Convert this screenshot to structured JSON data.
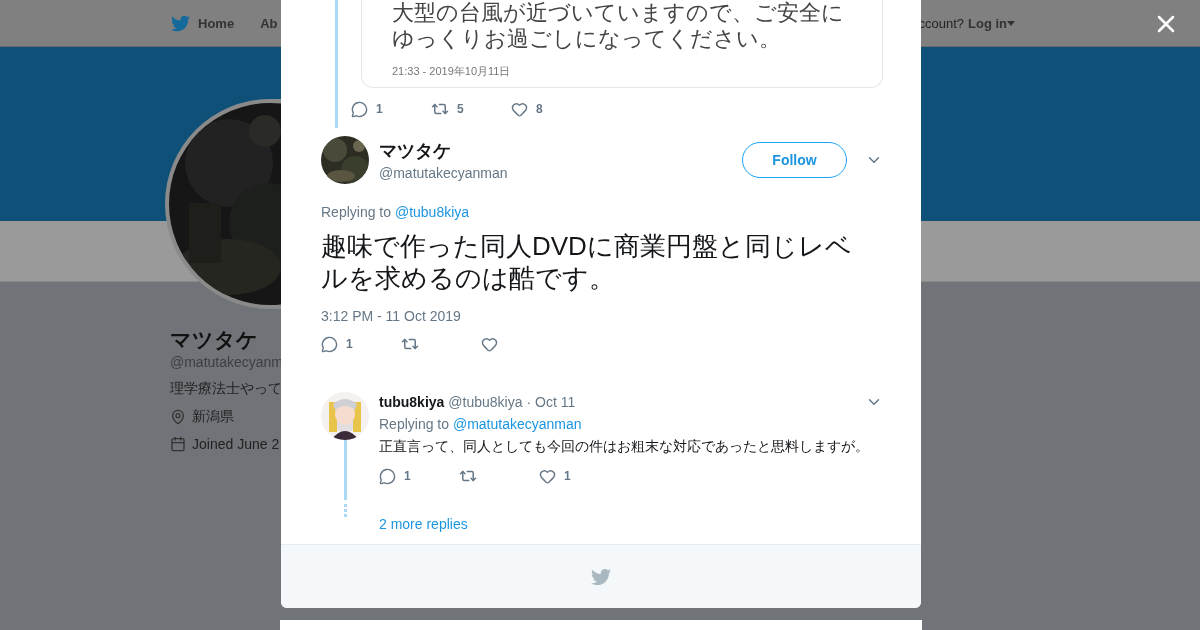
{
  "nav": {
    "items": [
      {
        "label": "Home",
        "kind": "home"
      },
      {
        "label": "Ab",
        "kind": "plain"
      }
    ],
    "account_prompt": "ccount?",
    "login": "Log in"
  },
  "profile": {
    "name": "マツタケ",
    "handle": "@matutakecyanm",
    "bio": "理学療法士やって",
    "location": "新潟県",
    "joined": "Joined June 2"
  },
  "modal": {
    "quoted_tweet": {
      "lines": [
        "大型の台風が近づいていますので、ご安全に",
        "ゆっくりお過ごしになってください。"
      ],
      "timestamp": "21:33 - 2019年10月11日"
    },
    "parent_actions": [
      {
        "kind": "reply",
        "count": "1"
      },
      {
        "kind": "retweet",
        "count": "5"
      },
      {
        "kind": "like",
        "count": "8"
      }
    ],
    "tweet": {
      "name": "マツタケ",
      "handle": "@matutakecyanman",
      "follow": "Follow",
      "replying_label": "Replying to",
      "replying_to": "@tubu8kiya",
      "text": "趣味で作った同人DVDに商業円盤と同じレベルを求めるのは酷です。",
      "timestamp": "3:12 PM - 11 Oct 2019",
      "actions": [
        {
          "kind": "reply",
          "count": "1"
        },
        {
          "kind": "retweet"
        },
        {
          "kind": "like"
        }
      ]
    },
    "replies": [
      {
        "name": "tubu8kiya",
        "handle": "@tubu8kiya",
        "time": "· Oct 11",
        "replying_label": "Replying to",
        "replying_to": "@matutakecyanman",
        "text": "正直言って、同人としても今回の件はお粗末な対応であったと思料しますが。",
        "actions": [
          {
            "kind": "reply",
            "count": "1"
          },
          {
            "kind": "retweet"
          },
          {
            "kind": "like",
            "count": "1"
          }
        ]
      }
    ],
    "more_replies": "2 more replies"
  }
}
